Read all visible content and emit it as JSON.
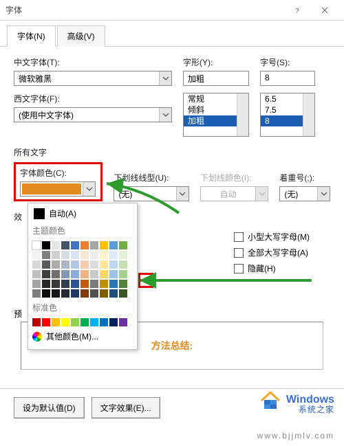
{
  "window": {
    "title": "字体"
  },
  "tabs": {
    "font": "字体(N)",
    "advanced": "高级(V)"
  },
  "fields": {
    "cn_font_label": "中文字体(T):",
    "cn_font_value": "微软雅黑",
    "west_font_label": "西文字体(F):",
    "west_font_value": "(使用中文字体)",
    "style_label": "字形(Y):",
    "style_value": "加粗",
    "style_options": [
      "常规",
      "倾斜",
      "加粗"
    ],
    "style_selected": "加粗",
    "size_label": "字号(S):",
    "size_value": "8",
    "size_options": [
      "6.5",
      "7.5",
      "8"
    ],
    "size_selected": "8"
  },
  "all_text_label": "所有文字",
  "font_color": {
    "label": "字体颜色(C):",
    "swatch_hex": "#e38a20"
  },
  "underline_style": {
    "label": "下划线线型(U):",
    "value": "(无)"
  },
  "underline_color": {
    "label": "下划线颜色(I):",
    "value": "自动"
  },
  "emphasis": {
    "label": "着重号(;):",
    "value": "(无)"
  },
  "effects_label": "效",
  "checkboxes": {
    "small_caps": "小型大写字母(M)",
    "all_caps": "全部大写字母(A)",
    "hidden": "隐藏(H)"
  },
  "preview_label": "预",
  "preview_text": "方法总结:",
  "popup": {
    "auto": "自动(A)",
    "theme": "主题颜色",
    "standard": "标准色",
    "more": "其他颜色(M)...",
    "theme_row0": [
      "#ffffff",
      "#000000",
      "#e7e6e6",
      "#44546a",
      "#4472c4",
      "#ed7d31",
      "#a5a5a5",
      "#ffc000",
      "#5b9bd5",
      "#70ad47"
    ],
    "theme_rows": [
      [
        "#f2f2f2",
        "#7f7f7f",
        "#d0cece",
        "#d6dce4",
        "#d9e2f3",
        "#fbe5d5",
        "#ededed",
        "#fff2cc",
        "#deebf6",
        "#e2efd9"
      ],
      [
        "#d8d8d8",
        "#595959",
        "#aeabab",
        "#adb9ca",
        "#b4c6e7",
        "#f7cbac",
        "#dbdbdb",
        "#fee599",
        "#bdd7ee",
        "#c5e0b3"
      ],
      [
        "#bfbfbf",
        "#3f3f3f",
        "#757070",
        "#8496b0",
        "#8eaadb",
        "#f4b183",
        "#c9c9c9",
        "#ffd965",
        "#9cc3e5",
        "#a8d08d"
      ],
      [
        "#a5a5a5",
        "#262626",
        "#3a3838",
        "#323f4f",
        "#2f5496",
        "#c55a11",
        "#7b7b7b",
        "#bf9000",
        "#2e75b5",
        "#538135"
      ],
      [
        "#7f7f7f",
        "#0c0c0c",
        "#171616",
        "#222a35",
        "#1f3864",
        "#833c0b",
        "#525252",
        "#7f6000",
        "#1e4e79",
        "#375623"
      ]
    ],
    "standard_row": [
      "#c00000",
      "#ff0000",
      "#ffc000",
      "#ffff00",
      "#92d050",
      "#00b050",
      "#00b0f0",
      "#0070c0",
      "#002060",
      "#7030a0"
    ]
  },
  "buttons": {
    "default": "设为默认值(D)",
    "effects": "文字效果(E)..."
  },
  "watermark": {
    "brand": "Windows",
    "sub": "系统之家",
    "url": "www.bjjmlv.com"
  }
}
